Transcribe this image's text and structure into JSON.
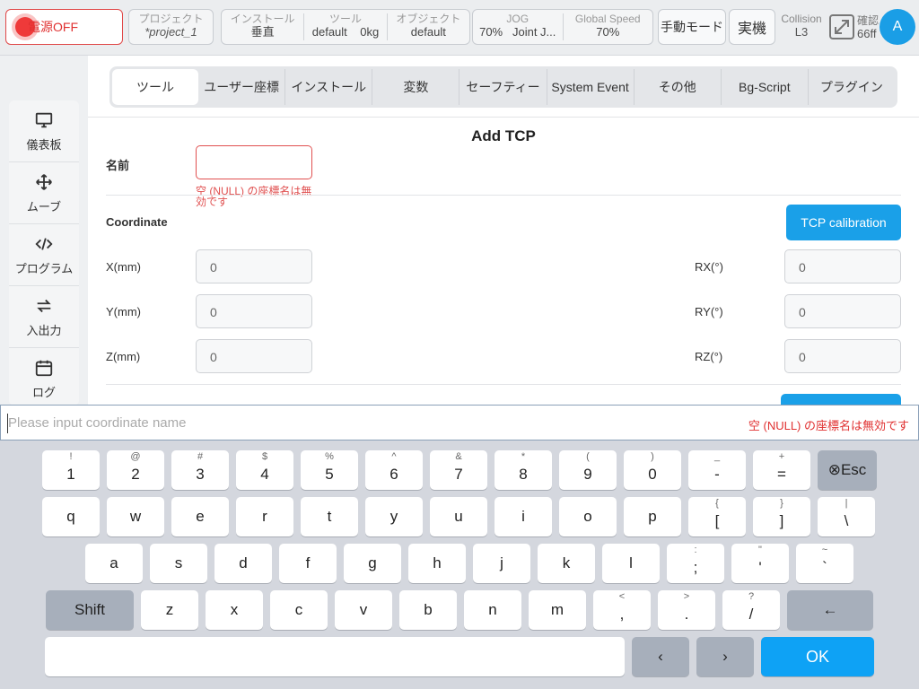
{
  "topbar": {
    "power_label": "電源OFF",
    "project_title": "プロジェクト",
    "project_value": "*project_1",
    "install_title": "インストール",
    "install_value": "垂直",
    "tool_title": "ツール",
    "tool_value": "default",
    "tool_payload": "0kg",
    "object_title": "オブジェクト",
    "object_value": "default",
    "jog_title": "JOG",
    "jog_speed": "70%",
    "jog_mode": "Joint J...",
    "global_speed_title": "Global Speed",
    "global_speed_value": "70%",
    "manual_mode": "手動モード",
    "real_robot": "実機",
    "collision_title": "Collision",
    "collision_value": "L3",
    "confirm_title": "確認",
    "confirm_value": "66ff",
    "avatar_letter": "A"
  },
  "sidebar": {
    "items": [
      {
        "label": "儀表板",
        "icon": "monitor-icon"
      },
      {
        "label": "ムーブ",
        "icon": "move-arrows-icon"
      },
      {
        "label": "プログラム",
        "icon": "code-icon"
      },
      {
        "label": "入出力",
        "icon": "swap-arrows-icon"
      },
      {
        "label": "ログ",
        "icon": "calendar-icon"
      }
    ]
  },
  "tabs": [
    "ツール",
    "ユーザー座標",
    "インストール",
    "変数",
    "セーフティー",
    "System Event",
    "その他",
    "Bg-Script",
    "プラグイン"
  ],
  "form": {
    "title": "Add TCP",
    "name_label": "名前",
    "name_value": "",
    "name_error_line1": "空 (NULL) の座標名は無",
    "name_error_line2": "効です",
    "coordinate_label": "Coordinate",
    "tcp_calibration": "TCP calibration",
    "x_label": "X(mm)",
    "x_value": "0",
    "y_label": "Y(mm)",
    "y_value": "0",
    "z_label": "Z(mm)",
    "z_value": "0",
    "rx_label": "RX(°)",
    "rx_value": "0",
    "ry_label": "RY(°)",
    "ry_value": "0",
    "rz_label": "RZ(°)",
    "rz_value": "0"
  },
  "keyboard": {
    "input_placeholder": "Please input coordinate name",
    "input_warning": "空 (NULL) の座標名は無効です",
    "row1": [
      [
        "!",
        "1"
      ],
      [
        "@",
        "2"
      ],
      [
        "#",
        "3"
      ],
      [
        "$",
        "4"
      ],
      [
        "%",
        "5"
      ],
      [
        "^",
        "6"
      ],
      [
        "&",
        "7"
      ],
      [
        "*",
        "8"
      ],
      [
        "(",
        "9"
      ],
      [
        ")",
        "0"
      ],
      [
        "_",
        "-"
      ],
      [
        "+",
        "="
      ]
    ],
    "esc_label": "⊗Esc",
    "row2": [
      [
        "",
        "q"
      ],
      [
        "",
        "w"
      ],
      [
        "",
        "e"
      ],
      [
        "",
        "r"
      ],
      [
        "",
        "t"
      ],
      [
        "",
        "y"
      ],
      [
        "",
        "u"
      ],
      [
        "",
        "i"
      ],
      [
        "",
        "o"
      ],
      [
        "",
        "p"
      ],
      [
        "{",
        "["
      ],
      [
        "}",
        "]"
      ],
      [
        "|",
        "\\"
      ]
    ],
    "row3": [
      [
        "",
        "a"
      ],
      [
        "",
        "s"
      ],
      [
        "",
        "d"
      ],
      [
        "",
        "f"
      ],
      [
        "",
        "g"
      ],
      [
        "",
        "h"
      ],
      [
        "",
        "j"
      ],
      [
        "",
        "k"
      ],
      [
        "",
        "l"
      ],
      [
        ":",
        ";"
      ],
      [
        "\"",
        "'"
      ],
      [
        "~",
        "`"
      ]
    ],
    "shift_label": "Shift",
    "row4": [
      [
        "",
        "z"
      ],
      [
        "",
        "x"
      ],
      [
        "",
        "c"
      ],
      [
        "",
        "v"
      ],
      [
        "",
        "b"
      ],
      [
        "",
        "n"
      ],
      [
        "",
        "m"
      ],
      [
        "<",
        ","
      ],
      [
        ">",
        "."
      ],
      [
        "?",
        "/"
      ]
    ],
    "backspace_label": "←",
    "left_label": "‹",
    "right_label": "›",
    "ok_label": "OK"
  }
}
